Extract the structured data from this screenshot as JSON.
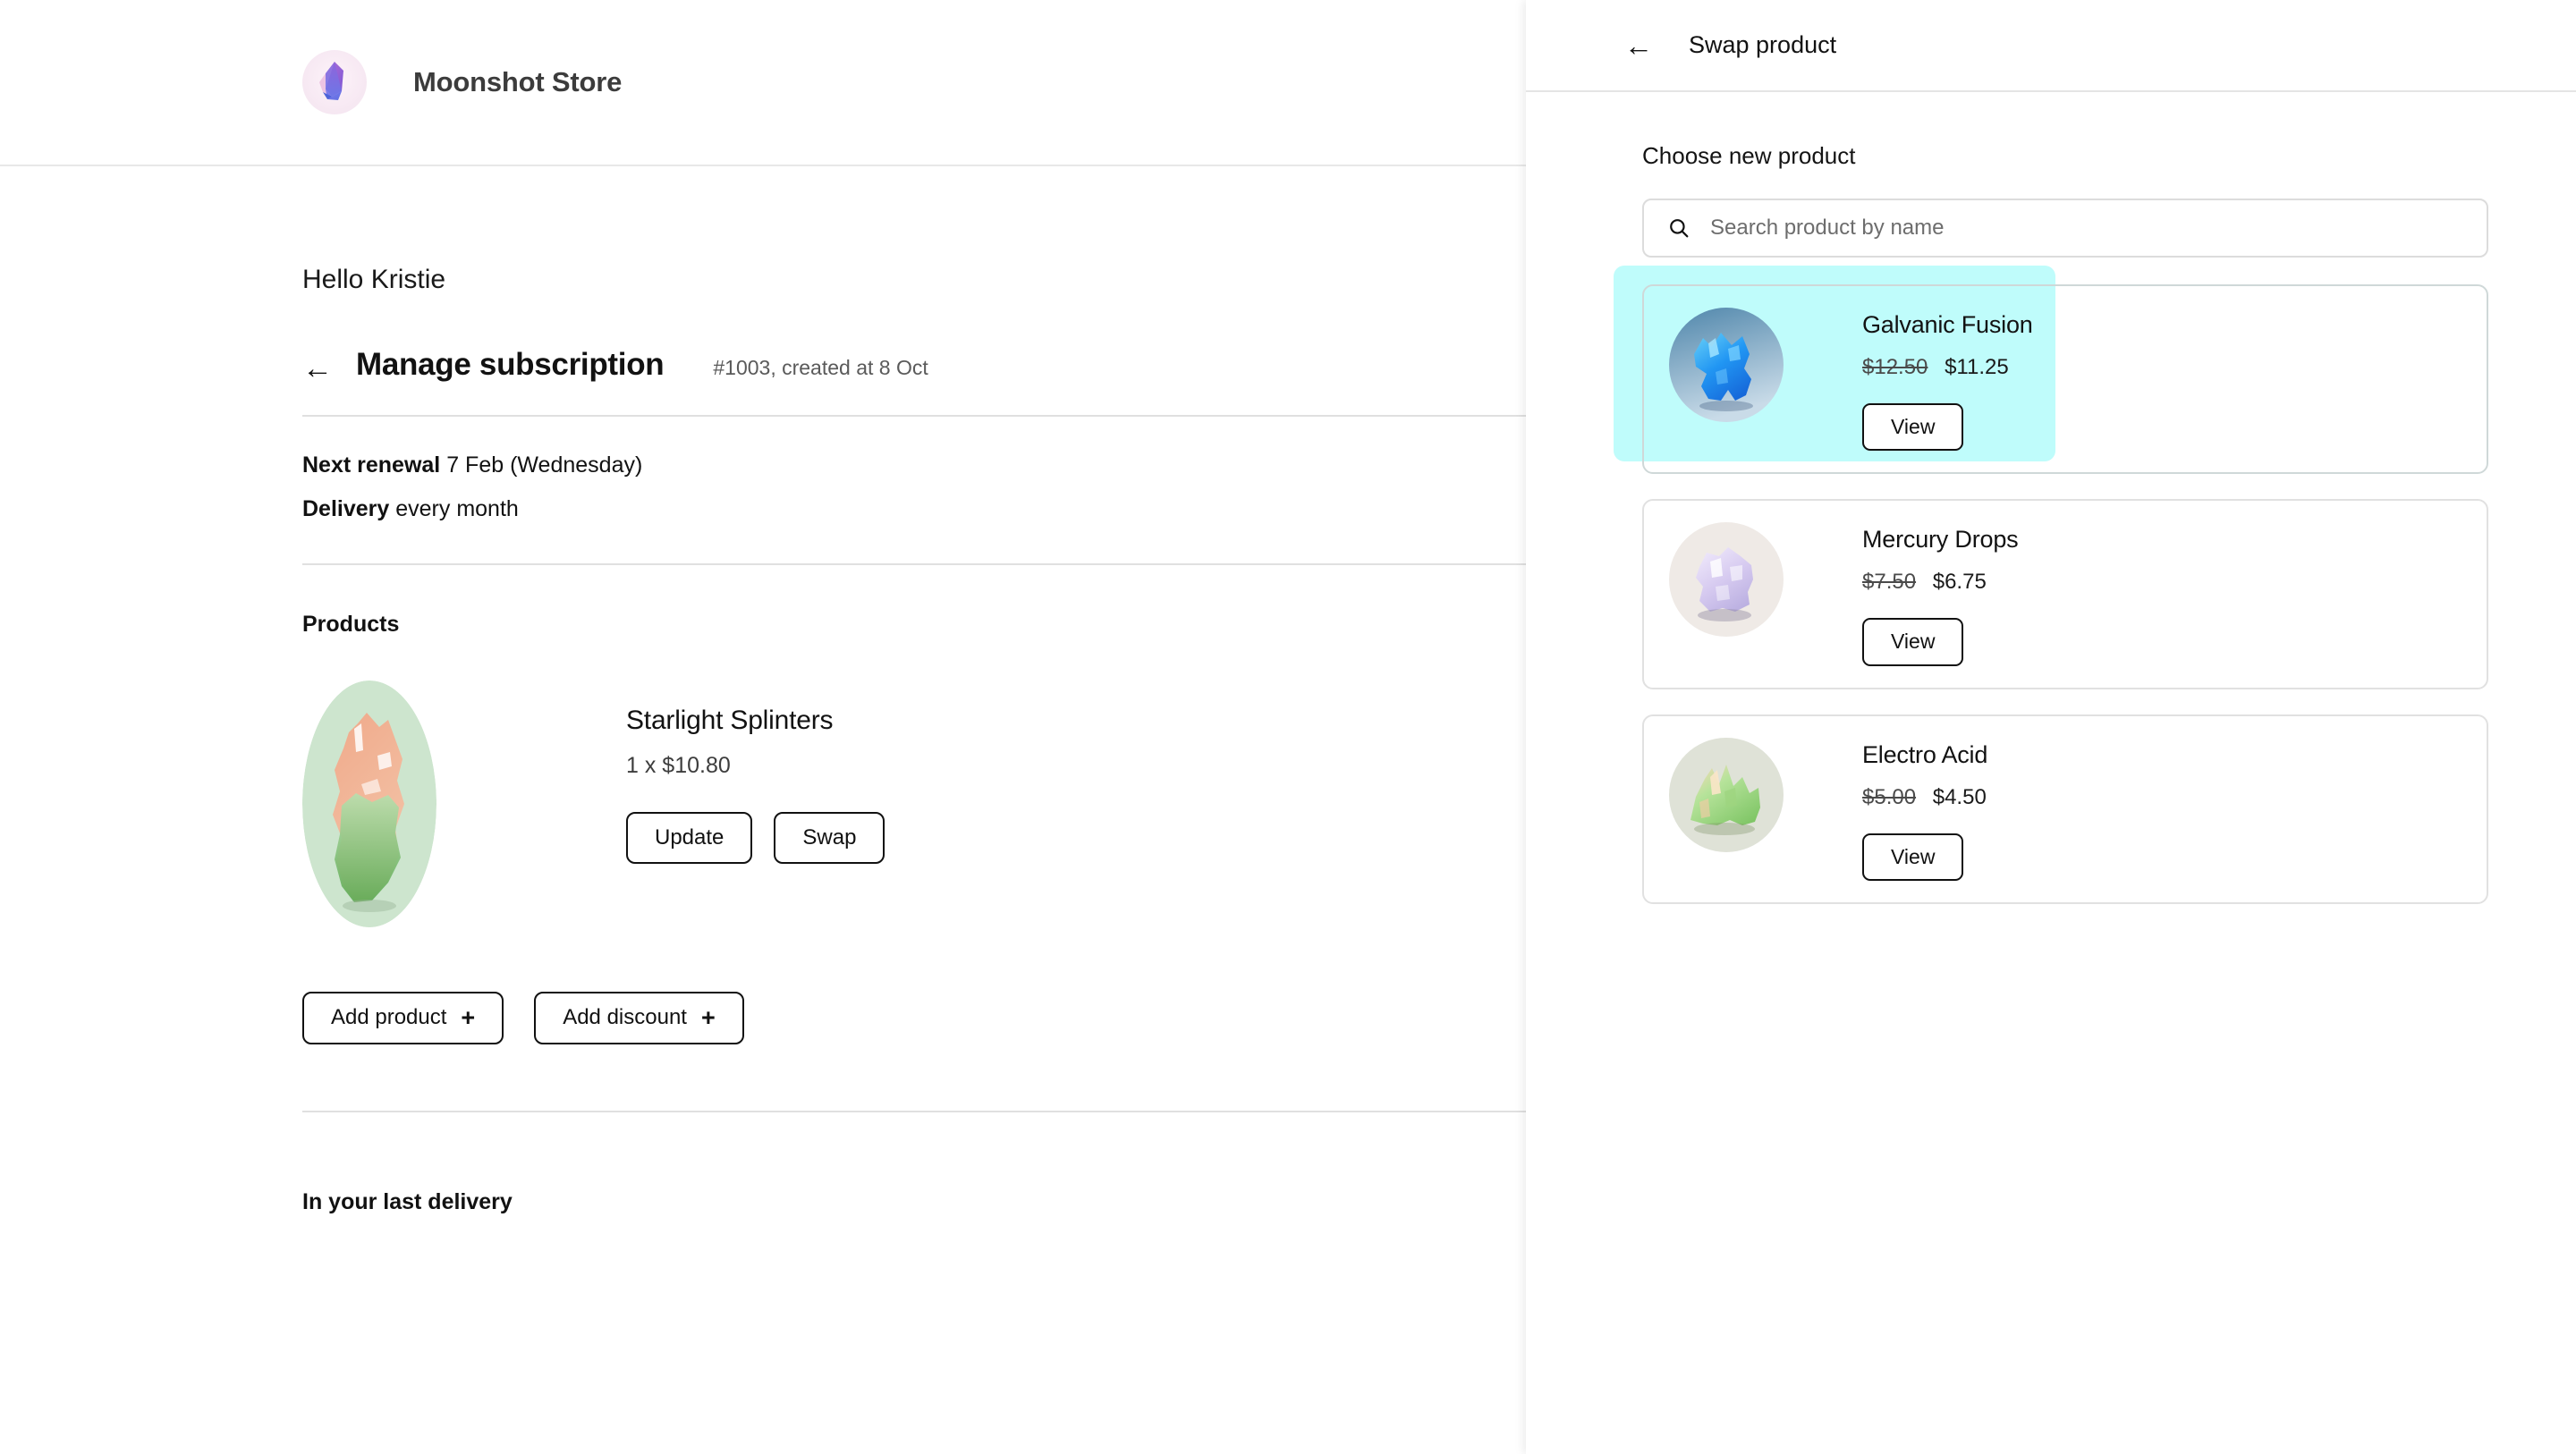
{
  "store": {
    "name": "Moonshot Store",
    "logo_icon": "gem-crystal-logo"
  },
  "account": {
    "greeting": "Hello Kristie"
  },
  "subscription": {
    "back_icon": "arrow-left-icon",
    "title": "Manage subscription",
    "meta": "#1003, created at 8 Oct",
    "details": [
      {
        "label": "Next renewal",
        "value": "7 Feb (Wednesday)"
      },
      {
        "label": "Delivery",
        "value": "every month"
      }
    ]
  },
  "products_section": {
    "heading": "Products",
    "items": [
      {
        "name": "Starlight Splinters",
        "quantity_price": "1 x $10.80",
        "image_icon": "starlight-splinters-thumbnail",
        "update_label": "Update",
        "swap_label": "Swap"
      }
    ],
    "add_product_label": "Add product",
    "add_discount_label": "Add discount",
    "plus_icon": "plus-icon"
  },
  "last_delivery": {
    "heading": "In your last delivery"
  },
  "swap_panel": {
    "back_icon": "arrow-left-icon",
    "title": "Swap product",
    "choose_label": "Choose new product",
    "search": {
      "icon": "search-icon",
      "placeholder": "Search product by name",
      "value": ""
    },
    "view_label": "View",
    "results": [
      {
        "name": "Galvanic Fusion",
        "price_old": "$12.50",
        "price_new": "$11.25",
        "image_icon": "galvanic-fusion-thumbnail",
        "selected": true
      },
      {
        "name": "Mercury Drops",
        "price_old": "$7.50",
        "price_new": "$6.75",
        "image_icon": "mercury-drops-thumbnail",
        "selected": false
      },
      {
        "name": "Electro Acid",
        "price_old": "$5.00",
        "price_new": "$4.50",
        "image_icon": "electro-acid-thumbnail",
        "selected": false
      }
    ]
  },
  "colors": {
    "highlight": "#bffcfb",
    "border": "#e1e1e1",
    "text": "#121212",
    "muted": "#5a5a5a"
  }
}
